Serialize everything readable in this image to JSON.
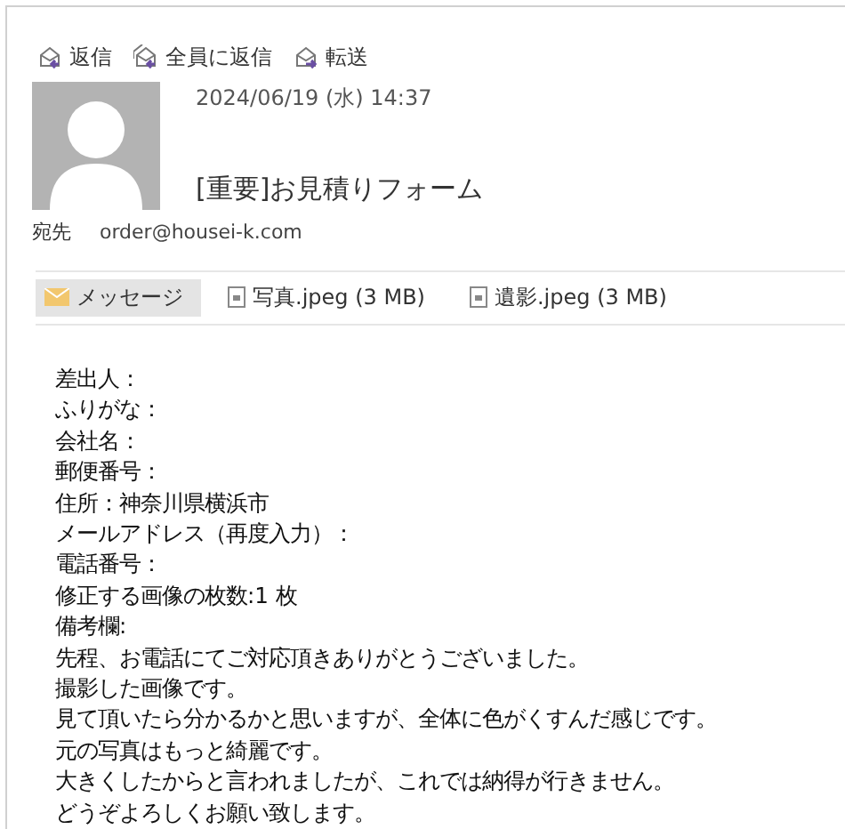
{
  "actions": [
    {
      "kind": "reply",
      "label": "返信"
    },
    {
      "kind": "reply_all",
      "label": "全員に返信"
    },
    {
      "kind": "forward",
      "label": "転送"
    }
  ],
  "message": {
    "date": "2024/06/19 (水) 14:37",
    "subject": "[重要]お見積りフォーム",
    "to_label": "宛先",
    "to": "order@housei-k.com"
  },
  "attachments": [
    {
      "kind": "message",
      "label": "メッセージ",
      "selected": true
    },
    {
      "kind": "file",
      "label": "写真.jpeg (3 MB)",
      "selected": false
    },
    {
      "kind": "file",
      "label": "遺影.jpeg (3 MB)",
      "selected": false
    }
  ],
  "body": [
    "差出人：",
    "ふりがな：",
    "会社名：",
    "郵便番号：",
    "住所：神奈川県横浜市",
    "メールアドレス（再度入力）：",
    "電話番号：",
    "修正する画像の枚数:1 枚",
    "備考欄:",
    "先程、お電話にてご対応頂きありがとうございました。",
    "撮影した画像です。",
    "見て頂いたら分かるかと思いますが、全体に色がくすんだ感じです。",
    "元の写真はもっと綺麗です。",
    "大きくしたからと言われましたが、これでは納得が行きません。",
    "どうぞよろしくお願い致します。"
  ]
}
